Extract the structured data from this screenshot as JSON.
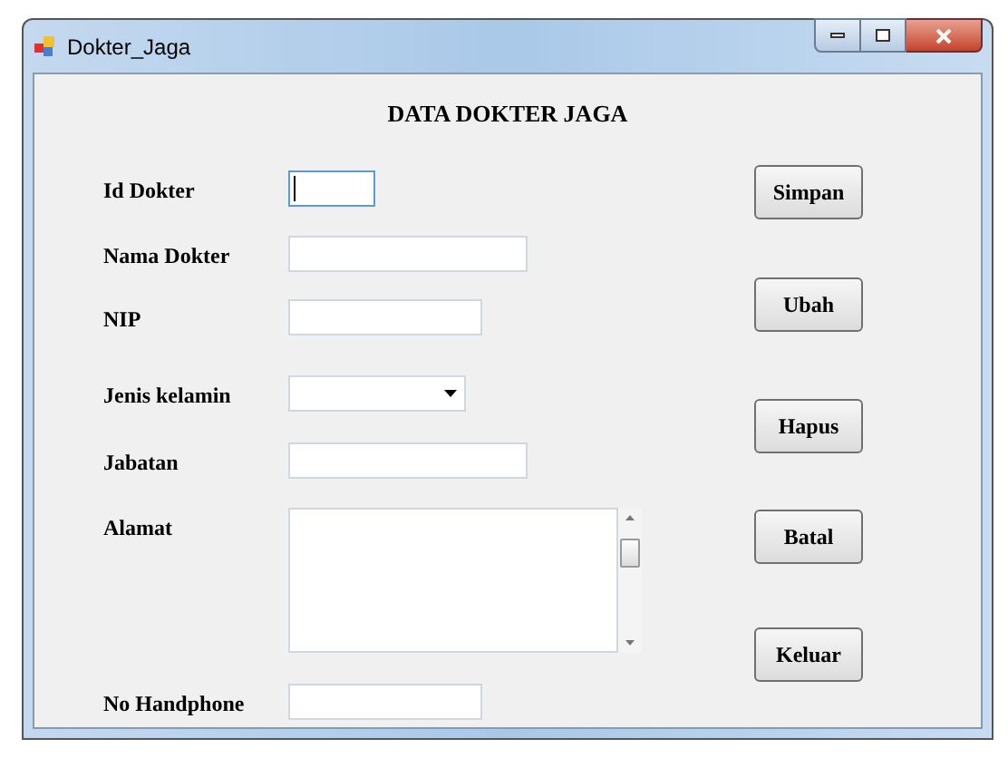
{
  "window": {
    "title": "Dokter_Jaga"
  },
  "heading": "DATA DOKTER JAGA",
  "fields": [
    {
      "label": "Id Dokter",
      "kind": "text",
      "focused": true
    },
    {
      "label": "Nama Dokter",
      "kind": "text",
      "focused": false
    },
    {
      "label": "NIP",
      "kind": "text",
      "focused": false
    },
    {
      "label": "Jenis kelamin",
      "kind": "combo",
      "focused": false
    },
    {
      "label": "Jabatan",
      "kind": "text",
      "focused": false
    },
    {
      "label": "Alamat",
      "kind": "textarea",
      "focused": false
    },
    {
      "label": "No Handphone",
      "kind": "text",
      "focused": false
    }
  ],
  "buttons": [
    "Simpan",
    "Ubah",
    "Hapus",
    "Batal",
    "Keluar"
  ]
}
